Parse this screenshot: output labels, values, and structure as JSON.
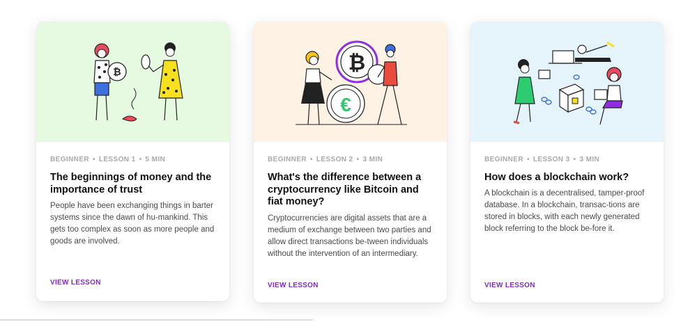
{
  "cards": [
    {
      "level": "BEGINNER",
      "lesson": "LESSON 1",
      "duration": "5 MIN",
      "title": "The beginnings of money and the importance of trust",
      "description": "People have been exchanging things in barter systems since the dawn of hu-mankind. This gets too complex as soon as more people and goods are involved.",
      "link_label": "VIEW LESSON",
      "illustration_bg": "#e6f9e1"
    },
    {
      "level": "BEGINNER",
      "lesson": "LESSON 2",
      "duration": "3 MIN",
      "title": "What's the difference between a cryptocurrency like Bitcoin and fiat money?",
      "description": "Cryptocurrencies are digital assets that are a medium of exchange between two parties and allow direct transactions be-tween individuals without the intervention of an intermediary.",
      "link_label": "VIEW LESSON",
      "illustration_bg": "#fdf2e3"
    },
    {
      "level": "BEGINNER",
      "lesson": "LESSON 3",
      "duration": "3 MIN",
      "title": "How does a blockchain work?",
      "description": "A blockchain is a decentralised, tamper-proof database. In a blockchain, transac-tions are stored in blocks, with each newly generated block referring to the block be-fore it.",
      "link_label": "VIEW LESSON",
      "illustration_bg": "#e5f4fb"
    }
  ],
  "colors": {
    "accent_link": "#7b2cbf",
    "meta_gray": "#a9a9a9",
    "illustration_green": "#2ecc71",
    "illustration_purple": "#8e2de2",
    "illustration_red": "#e74c3c",
    "illustration_yellow": "#f7e01d"
  }
}
